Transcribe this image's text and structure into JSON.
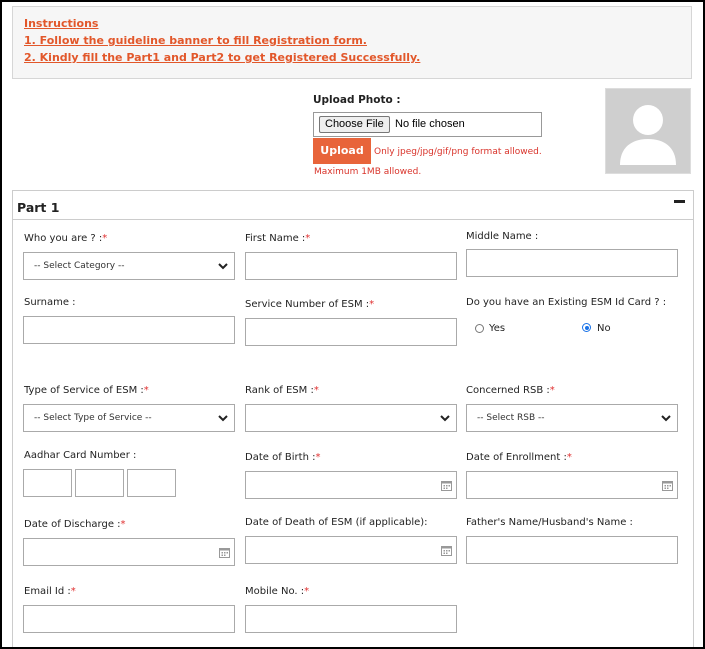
{
  "instructions": {
    "heading": "Instructions",
    "line1": "1. Follow the guideline banner to fill Registration form.",
    "line2": "2. Kindly fill the Part1 and Part2 to get Registered Successfully."
  },
  "photo": {
    "label": "Upload Photo :",
    "choose_button": "Choose File",
    "file_status": "No file chosen",
    "upload_button": "Upload",
    "format_note": "Only jpeg/jpg/gif/png format allowed.",
    "size_note": "Maximum 1MB allowed."
  },
  "part1": {
    "title": "Part 1",
    "who_label": "Who you are ? :",
    "who_value": "-- Select Category --",
    "first_name_label": "First Name :",
    "middle_name_label": "Middle Name :",
    "surname_label": "Surname :",
    "service_number_label": "Service Number of ESM :",
    "esm_card_label": "Do you have an Existing ESM Id Card ? :",
    "yes_label": "Yes",
    "no_label": "No",
    "type_service_label": "Type of Service of ESM :",
    "type_service_value": "-- Select Type of Service --",
    "rank_label": "Rank of ESM :",
    "rank_value": "",
    "rsb_label": "Concerned RSB :",
    "rsb_value": "-- Select RSB --",
    "aadhar_label": "Aadhar Card Number :",
    "dob_label": "Date of Birth :",
    "enrollment_label": "Date of Enrollment :",
    "discharge_label": "Date of Discharge :",
    "death_label": "Date of Death of ESM (if applicable):",
    "father_label": "Father's Name/Husband's Name :",
    "email_label": "Email Id :",
    "mobile_label": "Mobile No. :"
  },
  "colors": {
    "accent": "#e8643a",
    "error": "#d9342b",
    "required": "#e03030",
    "radio": "#1a73e8"
  }
}
